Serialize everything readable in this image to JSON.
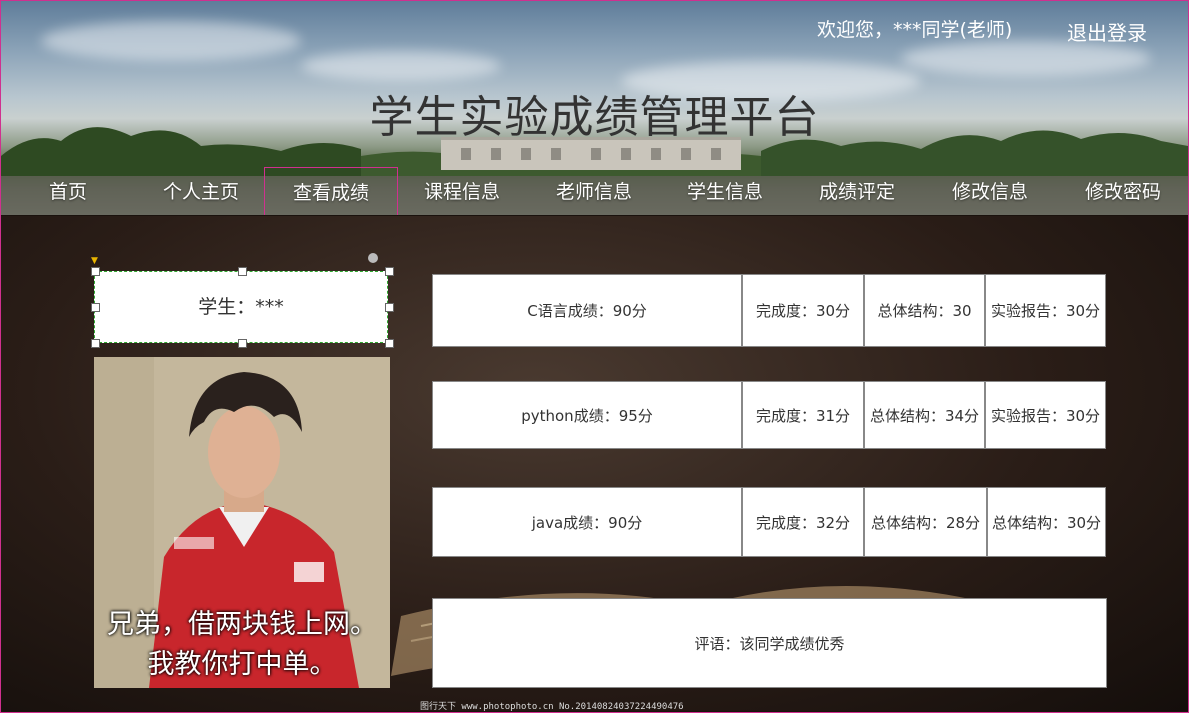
{
  "header": {
    "welcome": "欢迎您，***同学(老师)",
    "logout": "退出登录",
    "title": "学生实验成绩管理平台"
  },
  "nav": [
    {
      "label": "首页"
    },
    {
      "label": "个人主页"
    },
    {
      "label": "查看成绩",
      "active": true
    },
    {
      "label": "课程信息"
    },
    {
      "label": "老师信息"
    },
    {
      "label": "学生信息"
    },
    {
      "label": "成绩评定"
    },
    {
      "label": "修改信息"
    },
    {
      "label": "修改密码"
    }
  ],
  "student": {
    "label": "学生：***",
    "caption_line1": "兄弟，借两块钱上网。",
    "caption_line2": "我教你打中单。"
  },
  "grades": [
    {
      "course": "C语言成绩：90分",
      "c1": "完成度：30分",
      "c2": "总体结构：30",
      "c3": "实验报告：30分"
    },
    {
      "course": "python成绩：95分",
      "c1": "完成度：31分",
      "c2": "总体结构：34分",
      "c3": "实验报告：30分"
    },
    {
      "course": "java成绩：90分",
      "c1": "完成度：32分",
      "c2": "总体结构：28分",
      "c3": "总体结构：30分"
    }
  ],
  "comment": "评语：该同学成绩优秀",
  "watermark": "图行天下  www.photophoto.cn   No.20140824037224490476",
  "colors": {
    "accent": "#d0308f",
    "selection": "#2ea82e"
  }
}
